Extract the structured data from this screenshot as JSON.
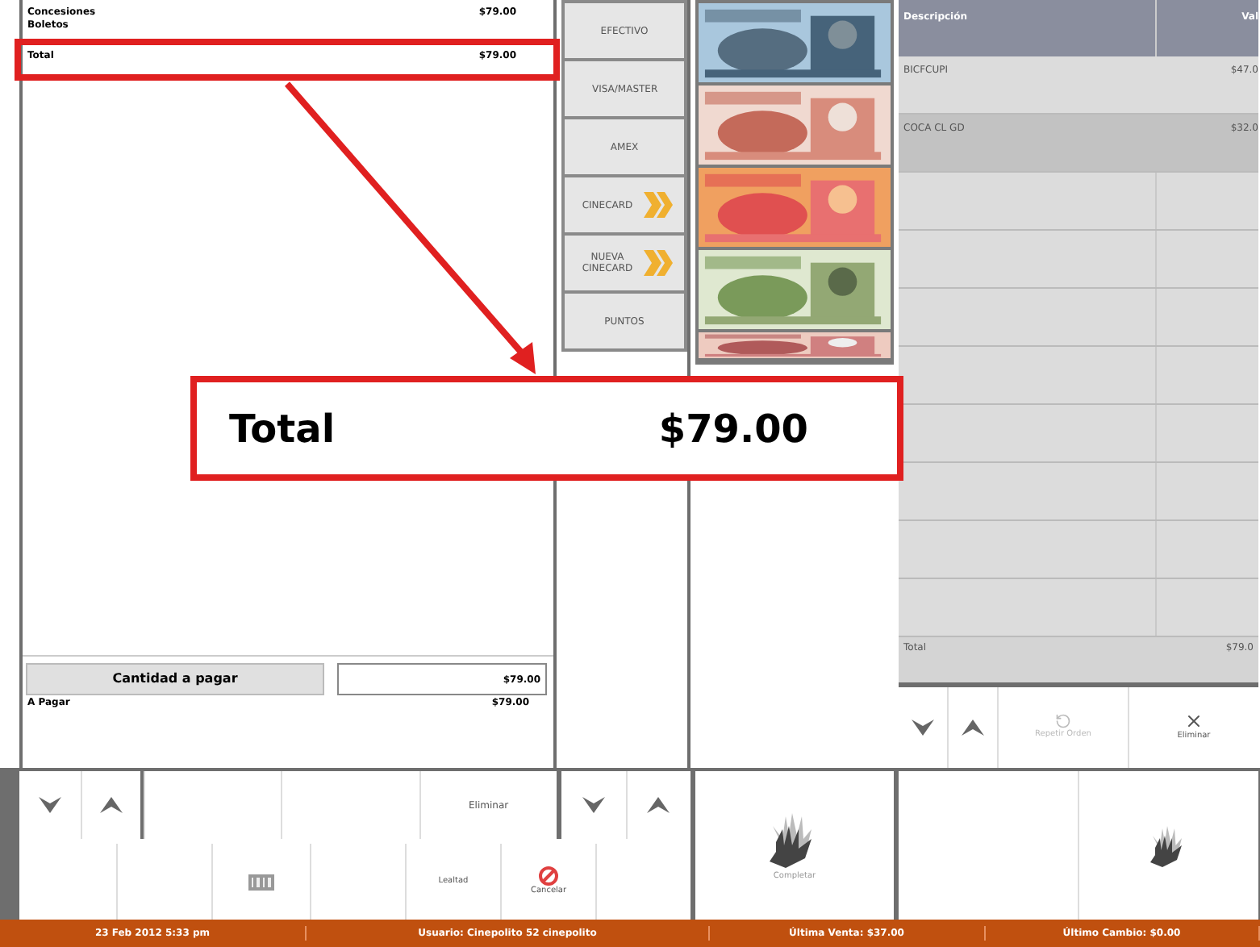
{
  "summary": {
    "items": [
      {
        "label": "Concesiones",
        "value": "$79.00"
      },
      {
        "label": "Boletos"
      }
    ],
    "total": {
      "label": "Total",
      "value": "$79.00"
    }
  },
  "amount": {
    "button": "Cantidad a pagar",
    "value": "$79.00"
  },
  "to_pay": {
    "label": "A Pagar",
    "value": "$79.00"
  },
  "payment_methods": [
    {
      "label": "EFECTIVO",
      "kind": "plain"
    },
    {
      "label": "VISA/MASTER",
      "kind": "plain"
    },
    {
      "label": "AMEX",
      "kind": "plain"
    },
    {
      "label": "CINECARD",
      "kind": "card"
    },
    {
      "label": "NUEVA CINECARD",
      "kind": "card"
    },
    {
      "label": "PUNTOS",
      "kind": "plain"
    }
  ],
  "table": {
    "columns": [
      "Descripción",
      "Val"
    ],
    "rows": [
      {
        "cells": [
          "BICFCUPI",
          "$47.0"
        ],
        "selected": false
      },
      {
        "cells": [
          "COCA CL GD",
          "$32.0"
        ],
        "selected": true
      }
    ],
    "total": {
      "label": "Total",
      "value": "$79.0"
    }
  },
  "table_actions": [
    {
      "label": "Repetir Orden",
      "kind": "repeat",
      "disabled": true
    },
    {
      "label": "Eliminar",
      "kind": "delete",
      "disabled": false
    }
  ],
  "left_delete": "Eliminar",
  "bottom_actions": [
    {
      "label": "Lealtad",
      "kind": "text"
    },
    {
      "label": "Cancelar",
      "kind": "cancel"
    }
  ],
  "complete": "Completar",
  "status_bar": [
    "23 Feb 2012 5:33 pm",
    "Usuario: Cinepolito 52 cinepolito",
    "Última Venta: $37.00",
    "Último Cambio: $0.00"
  ],
  "callout": {
    "label": "Total",
    "value": "$79.00"
  }
}
